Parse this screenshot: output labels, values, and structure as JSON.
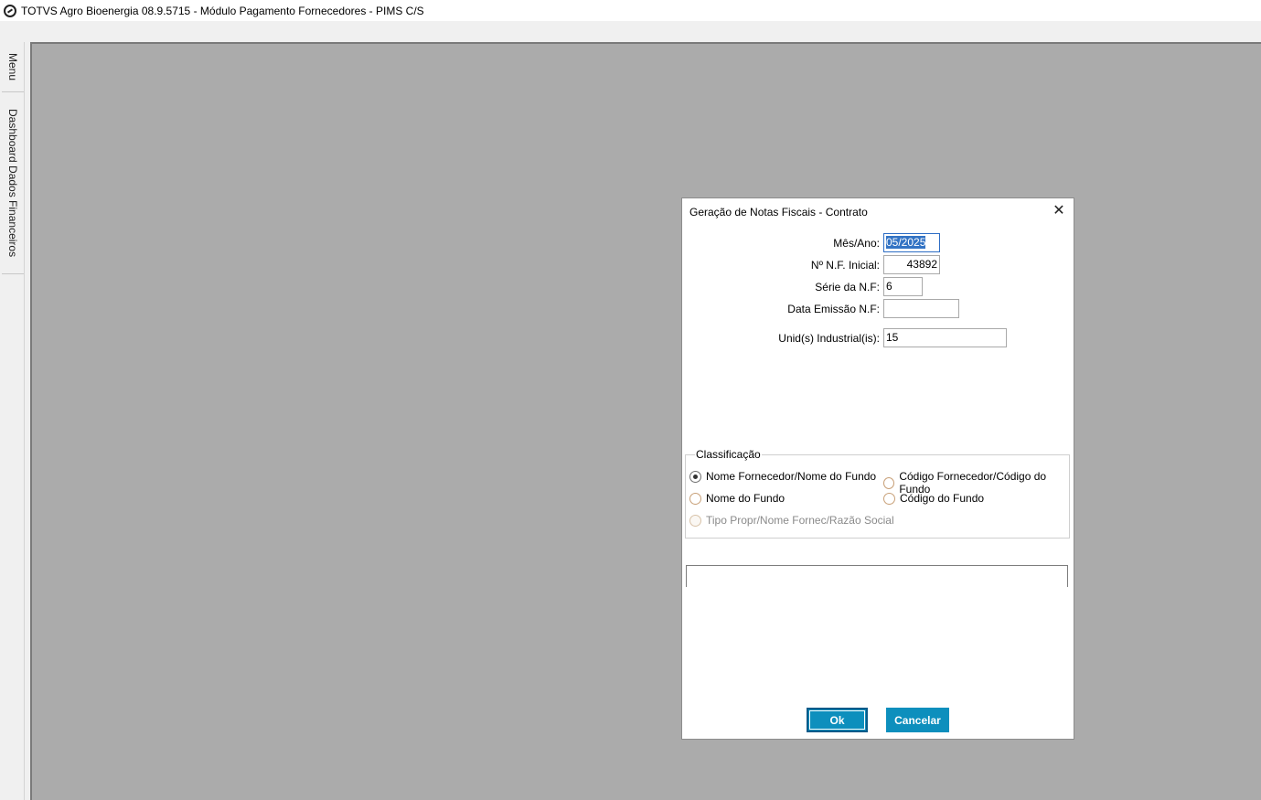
{
  "window": {
    "title": "TOTVS Agro Bioenergia 08.9.5715 - Módulo Pagamento Fornecedores - PIMS C/S",
    "icon": "totvs-logo-icon"
  },
  "sidebar": {
    "tabs": [
      {
        "label": "Menu"
      },
      {
        "label": "Dashboard Dados Financeiros"
      }
    ]
  },
  "dialog": {
    "title": "Geração de Notas Fiscais - Contrato",
    "close_icon": "close-icon",
    "fields": {
      "mes_ano": {
        "label": "Mês/Ano:",
        "value": "05/2025"
      },
      "nf_inicial": {
        "label": "Nº N.F. Inicial:",
        "value": "43892"
      },
      "serie_nf": {
        "label": "Série da N.F:",
        "value": "6"
      },
      "data_emissao": {
        "label": "Data Emissão N.F:",
        "value": ""
      },
      "unid_industrial": {
        "label": "Unid(s) Industrial(is):",
        "value": "15"
      }
    },
    "classificacao": {
      "legend": "Classificação",
      "options": [
        {
          "label": "Nome Fornecedor/Nome do Fundo",
          "checked": true,
          "disabled": false
        },
        {
          "label": "Código Fornecedor/Código do Fundo",
          "checked": false,
          "disabled": false
        },
        {
          "label": "Nome do Fundo",
          "checked": false,
          "disabled": false
        },
        {
          "label": "Código do Fundo",
          "checked": false,
          "disabled": false
        },
        {
          "label": "Tipo Propr/Nome Fornec/Razão Social",
          "checked": false,
          "disabled": true
        }
      ]
    },
    "buttons": {
      "ok": "Ok",
      "cancel": "Cancelar"
    }
  },
  "colors": {
    "button_bg": "#0d8fbd",
    "mdi_bg": "#ababab",
    "selection": "#3373c4"
  }
}
